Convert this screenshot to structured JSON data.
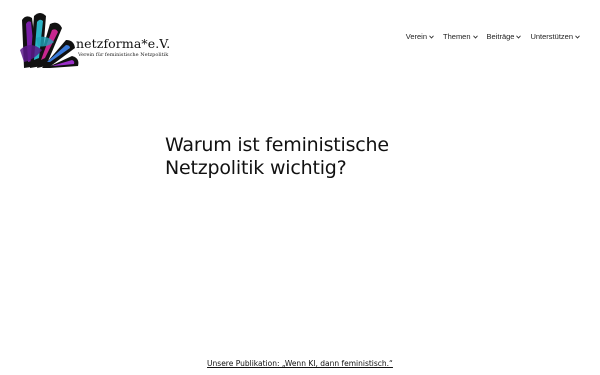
{
  "site": {
    "name": "netzforma*e.V.",
    "tagline": "Verein für feministische Netzpolitik"
  },
  "nav": {
    "items": [
      {
        "label": "Verein"
      },
      {
        "label": "Themen"
      },
      {
        "label": "Beiträge"
      },
      {
        "label": "Unterstützen"
      }
    ]
  },
  "main": {
    "headline_line1": "Warum ist feministische",
    "headline_line2": "Netzpolitik wichtig?"
  },
  "footer_link": {
    "label": "Unsere Publikation: „Wenn KI, dann feministisch.“"
  },
  "colors": {
    "text": "#111111",
    "background": "#ffffff",
    "logo_purple": "#7a1fa8",
    "logo_teal": "#2bb3c6",
    "logo_magenta": "#c8278f"
  }
}
